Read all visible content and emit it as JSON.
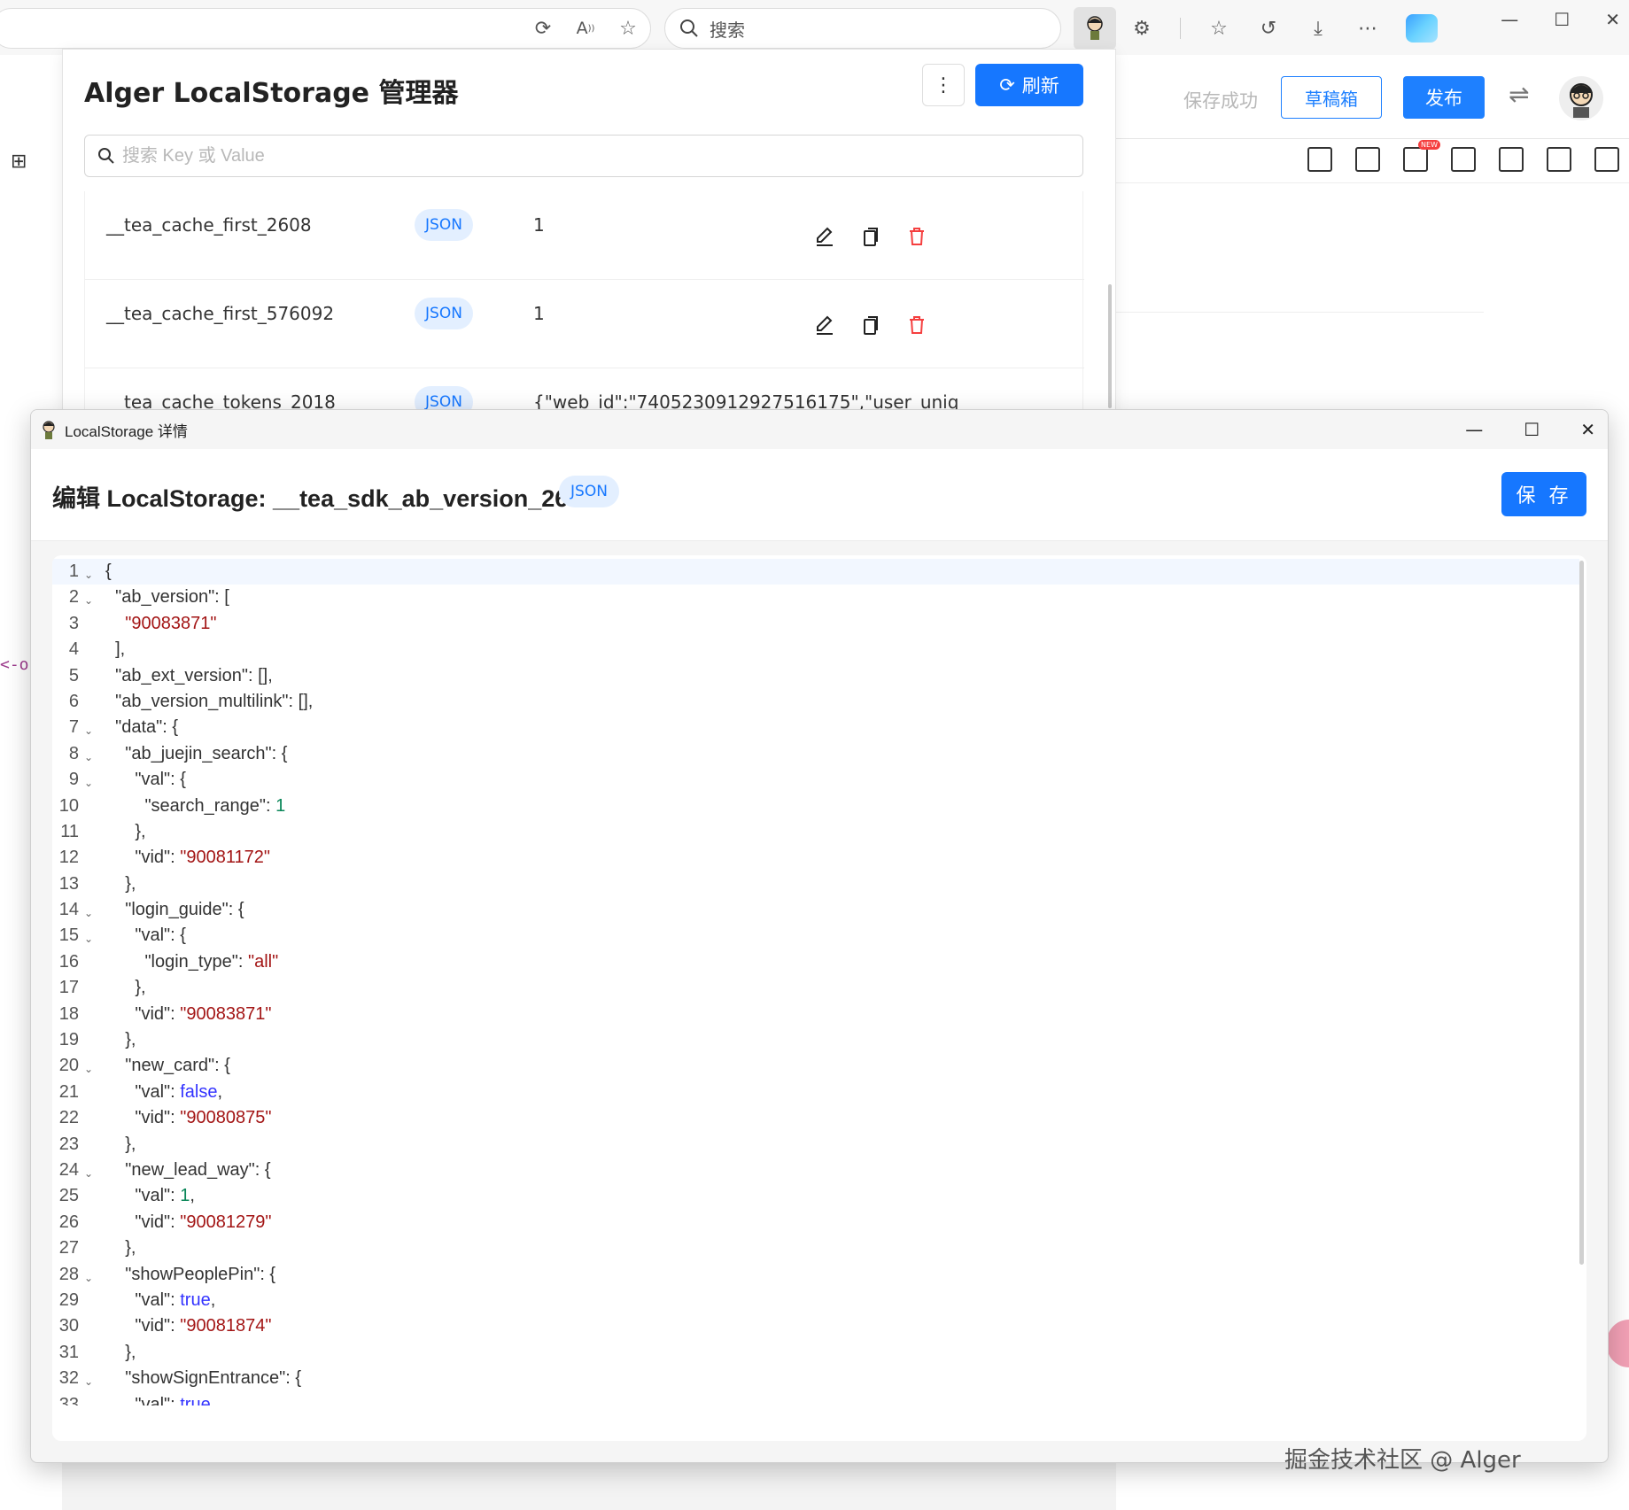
{
  "browser": {
    "search_placeholder": "搜索"
  },
  "editor_page": {
    "save_status": "保存成功",
    "draft_label": "草稿箱",
    "publish_label": "发布",
    "code_fragment": "<-or"
  },
  "manager": {
    "title": "Alger LocalStorage 管理器",
    "refresh_label": "刷新",
    "search_placeholder": "搜索 Key 或 Value",
    "rows": [
      {
        "key": "__tea_cache_first_2608",
        "type": "JSON",
        "value": "1"
      },
      {
        "key": "__tea_cache_first_576092",
        "type": "JSON",
        "value": "1"
      },
      {
        "key": "__tea_cache_tokens_2018",
        "type": "JSON",
        "value": "{\"web_id\":\"7405230912927516175\",\"user_uniq"
      }
    ]
  },
  "detail": {
    "window_title": "LocalStorage 详情",
    "heading": "编辑 LocalStorage: __tea_sdk_ab_version_2608",
    "type_badge": "JSON",
    "save_label": "保 存",
    "lines": [
      "{",
      "  \"ab_version\": [",
      "    \"90083871\"",
      "  ],",
      "  \"ab_ext_version\": [],",
      "  \"ab_version_multilink\": [],",
      "  \"data\": {",
      "    \"ab_juejin_search\": {",
      "      \"val\": {",
      "        \"search_range\": 1",
      "      },",
      "      \"vid\": \"90081172\"",
      "    },",
      "    \"login_guide\": {",
      "      \"val\": {",
      "        \"login_type\": \"all\"",
      "      },",
      "      \"vid\": \"90083871\"",
      "    },",
      "    \"new_card\": {",
      "      \"val\": false,",
      "      \"vid\": \"90080875\"",
      "    },",
      "    \"new_lead_way\": {",
      "      \"val\": 1,",
      "      \"vid\": \"90081279\"",
      "    },",
      "    \"showPeoplePin\": {",
      "      \"val\": true,",
      "      \"vid\": \"90081874\"",
      "    },",
      "    \"showSignEntrance\": {",
      "      \"val\": true,"
    ],
    "foldable_lines": [
      1,
      2,
      7,
      8,
      9,
      14,
      15,
      20,
      24,
      28,
      32
    ]
  },
  "watermark": "掘金技术社区 @ Alger",
  "colors": {
    "primary": "#1677ff",
    "juejin_blue": "#1e80ff",
    "delete_red": "#f53f3f",
    "string": "#a31515",
    "number": "#098658",
    "keyword": "#0000ff"
  }
}
